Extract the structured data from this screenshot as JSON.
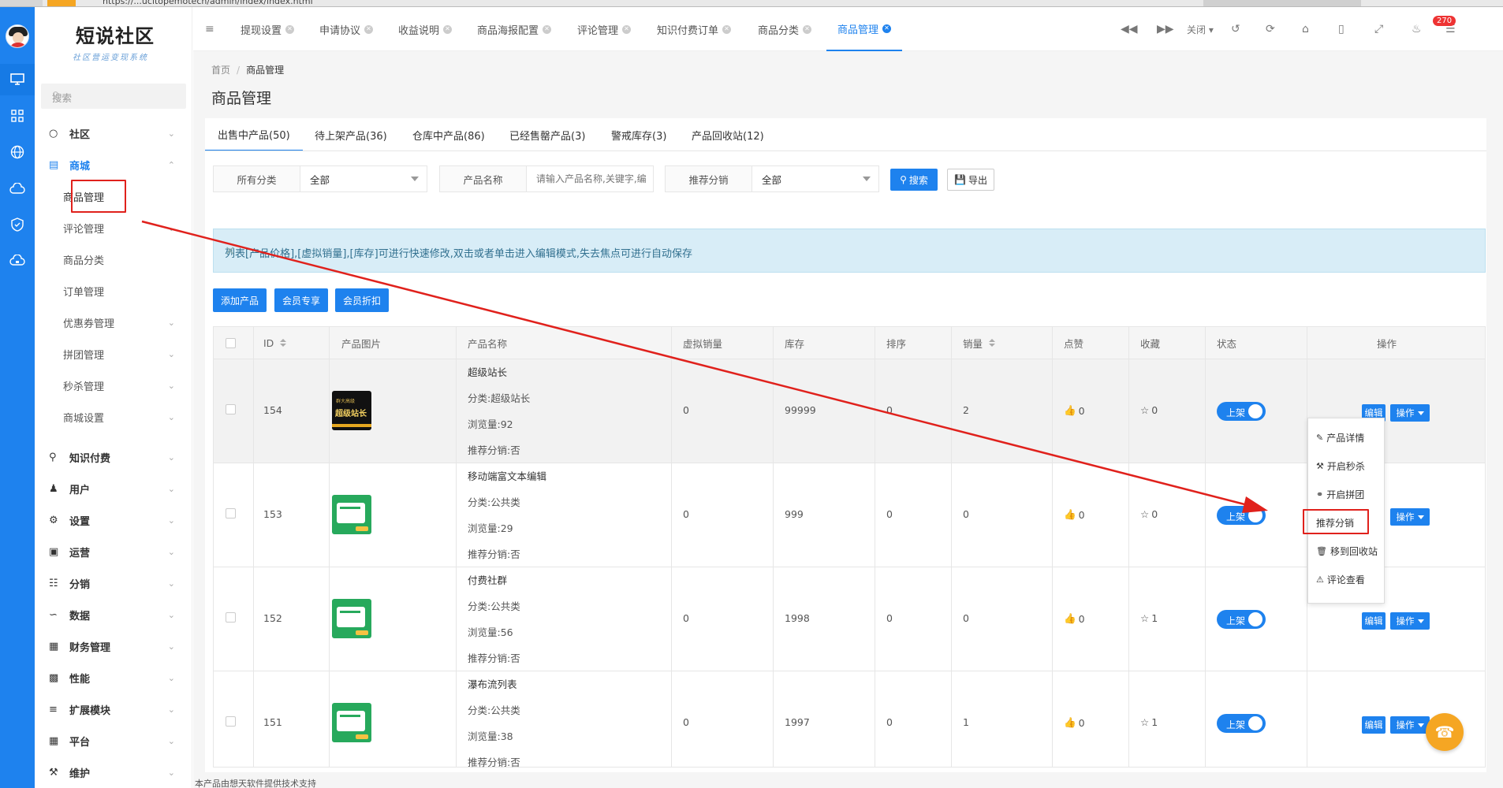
{
  "browser": {
    "url": "https://...ucitopemotech/admin/index/index.html"
  },
  "brand": {
    "logo_main": "短说社区",
    "logo_sub": "社区营运变现系统"
  },
  "sidebar": {
    "search_placeholder": "搜索",
    "menu": [
      {
        "label": "社区",
        "icon": "chat-icon"
      },
      {
        "label": "商城",
        "icon": "shop-icon"
      },
      {
        "label": "知识付费",
        "icon": "bulb-icon"
      },
      {
        "label": "用户",
        "icon": "users-icon"
      },
      {
        "label": "设置",
        "icon": "gear-icon"
      },
      {
        "label": "运营",
        "icon": "chart-icon"
      },
      {
        "label": "分销",
        "icon": "tree-icon"
      },
      {
        "label": "数据",
        "icon": "line-chart-icon"
      },
      {
        "label": "财务管理",
        "icon": "wallet-icon"
      },
      {
        "label": "性能",
        "icon": "gauge-icon"
      },
      {
        "label": "扩展模块",
        "icon": "puzzle-icon"
      },
      {
        "label": "平台",
        "icon": "grid-icon"
      },
      {
        "label": "维护",
        "icon": "wrench-icon"
      }
    ],
    "shop_sub": [
      "商品管理",
      "评论管理",
      "商品分类",
      "订单管理",
      "优惠券管理",
      "拼团管理",
      "秒杀管理",
      "商城设置"
    ]
  },
  "tabs": [
    {
      "label": "提现设置"
    },
    {
      "label": "申请协议"
    },
    {
      "label": "收益说明"
    },
    {
      "label": "商品海报配置"
    },
    {
      "label": "评论管理"
    },
    {
      "label": "知识付费订单"
    },
    {
      "label": "商品分类"
    },
    {
      "label": "商品管理"
    }
  ],
  "toolbar": {
    "close_label": "关闭",
    "notification_count": "270"
  },
  "breadcrumb": {
    "home": "首页",
    "current": "商品管理"
  },
  "page_title": "商品管理",
  "product_tabs": [
    "出售中产品(50)",
    "待上架产品(36)",
    "仓库中产品(86)",
    "已经售罄产品(3)",
    "警戒库存(3)",
    "产品回收站(12)"
  ],
  "filters": {
    "category_label": "所有分类",
    "category_value": "全部",
    "name_label": "产品名称",
    "name_placeholder": "请输入产品名称,关键字,编",
    "dist_label": "推荐分销",
    "dist_value": "全部",
    "search_btn": "搜索",
    "export_btn": "导出"
  },
  "alert_text": "列表[产品价格],[虚拟销量],[库存]可进行快速修改,双击或者单击进入编辑模式,失去焦点可进行自动保存",
  "actions": {
    "add": "添加产品",
    "vip": "会员专享",
    "vip_discount": "会员折扣"
  },
  "table": {
    "headers": [
      "ID",
      "产品图片",
      "产品名称",
      "虚拟销量",
      "库存",
      "排序",
      "销量",
      "点赞",
      "收藏",
      "状态",
      "操作"
    ],
    "rows": [
      {
        "id": "154",
        "name": "超级站长",
        "category": "分类:超级站长",
        "views": "浏览量:92",
        "dist": "推荐分销:否",
        "virtual_sales": "0",
        "stock": "99999",
        "sort": "0",
        "sales": "2",
        "likes": "0",
        "favs": "0",
        "status": "上架",
        "thumb": "dark",
        "thumb_line1": "群大高级",
        "thumb_line2": "超级站长"
      },
      {
        "id": "153",
        "name": "移动端富文本编辑",
        "category": "分类:公共类",
        "views": "浏览量:29",
        "dist": "推荐分销:否",
        "virtual_sales": "0",
        "stock": "999",
        "sort": "0",
        "sales": "0",
        "likes": "0",
        "favs": "0",
        "status": "上架",
        "thumb": "green"
      },
      {
        "id": "152",
        "name": "付费社群",
        "category": "分类:公共类",
        "views": "浏览量:56",
        "dist": "推荐分销:否",
        "virtual_sales": "0",
        "stock": "1998",
        "sort": "0",
        "sales": "0",
        "likes": "0",
        "favs": "1",
        "status": "上架",
        "thumb": "green"
      },
      {
        "id": "151",
        "name": "瀑布流列表",
        "category": "分类:公共类",
        "views": "浏览量:38",
        "dist": "推荐分销:否",
        "virtual_sales": "0",
        "stock": "1997",
        "sort": "0",
        "sales": "1",
        "likes": "0",
        "favs": "1",
        "status": "上架",
        "thumb": "green"
      }
    ],
    "edit_label": "编辑",
    "op_label": "操作"
  },
  "dropdown": [
    "产品详情",
    "开启秒杀",
    "开启拼团",
    "推荐分销",
    "移到回收站",
    "评论查看"
  ],
  "footer": "本产品由想天软件提供技术支持",
  "colors": {
    "primary": "#1e82ee",
    "annotation": "#e0211c",
    "alert_bg": "#d8edf7"
  }
}
